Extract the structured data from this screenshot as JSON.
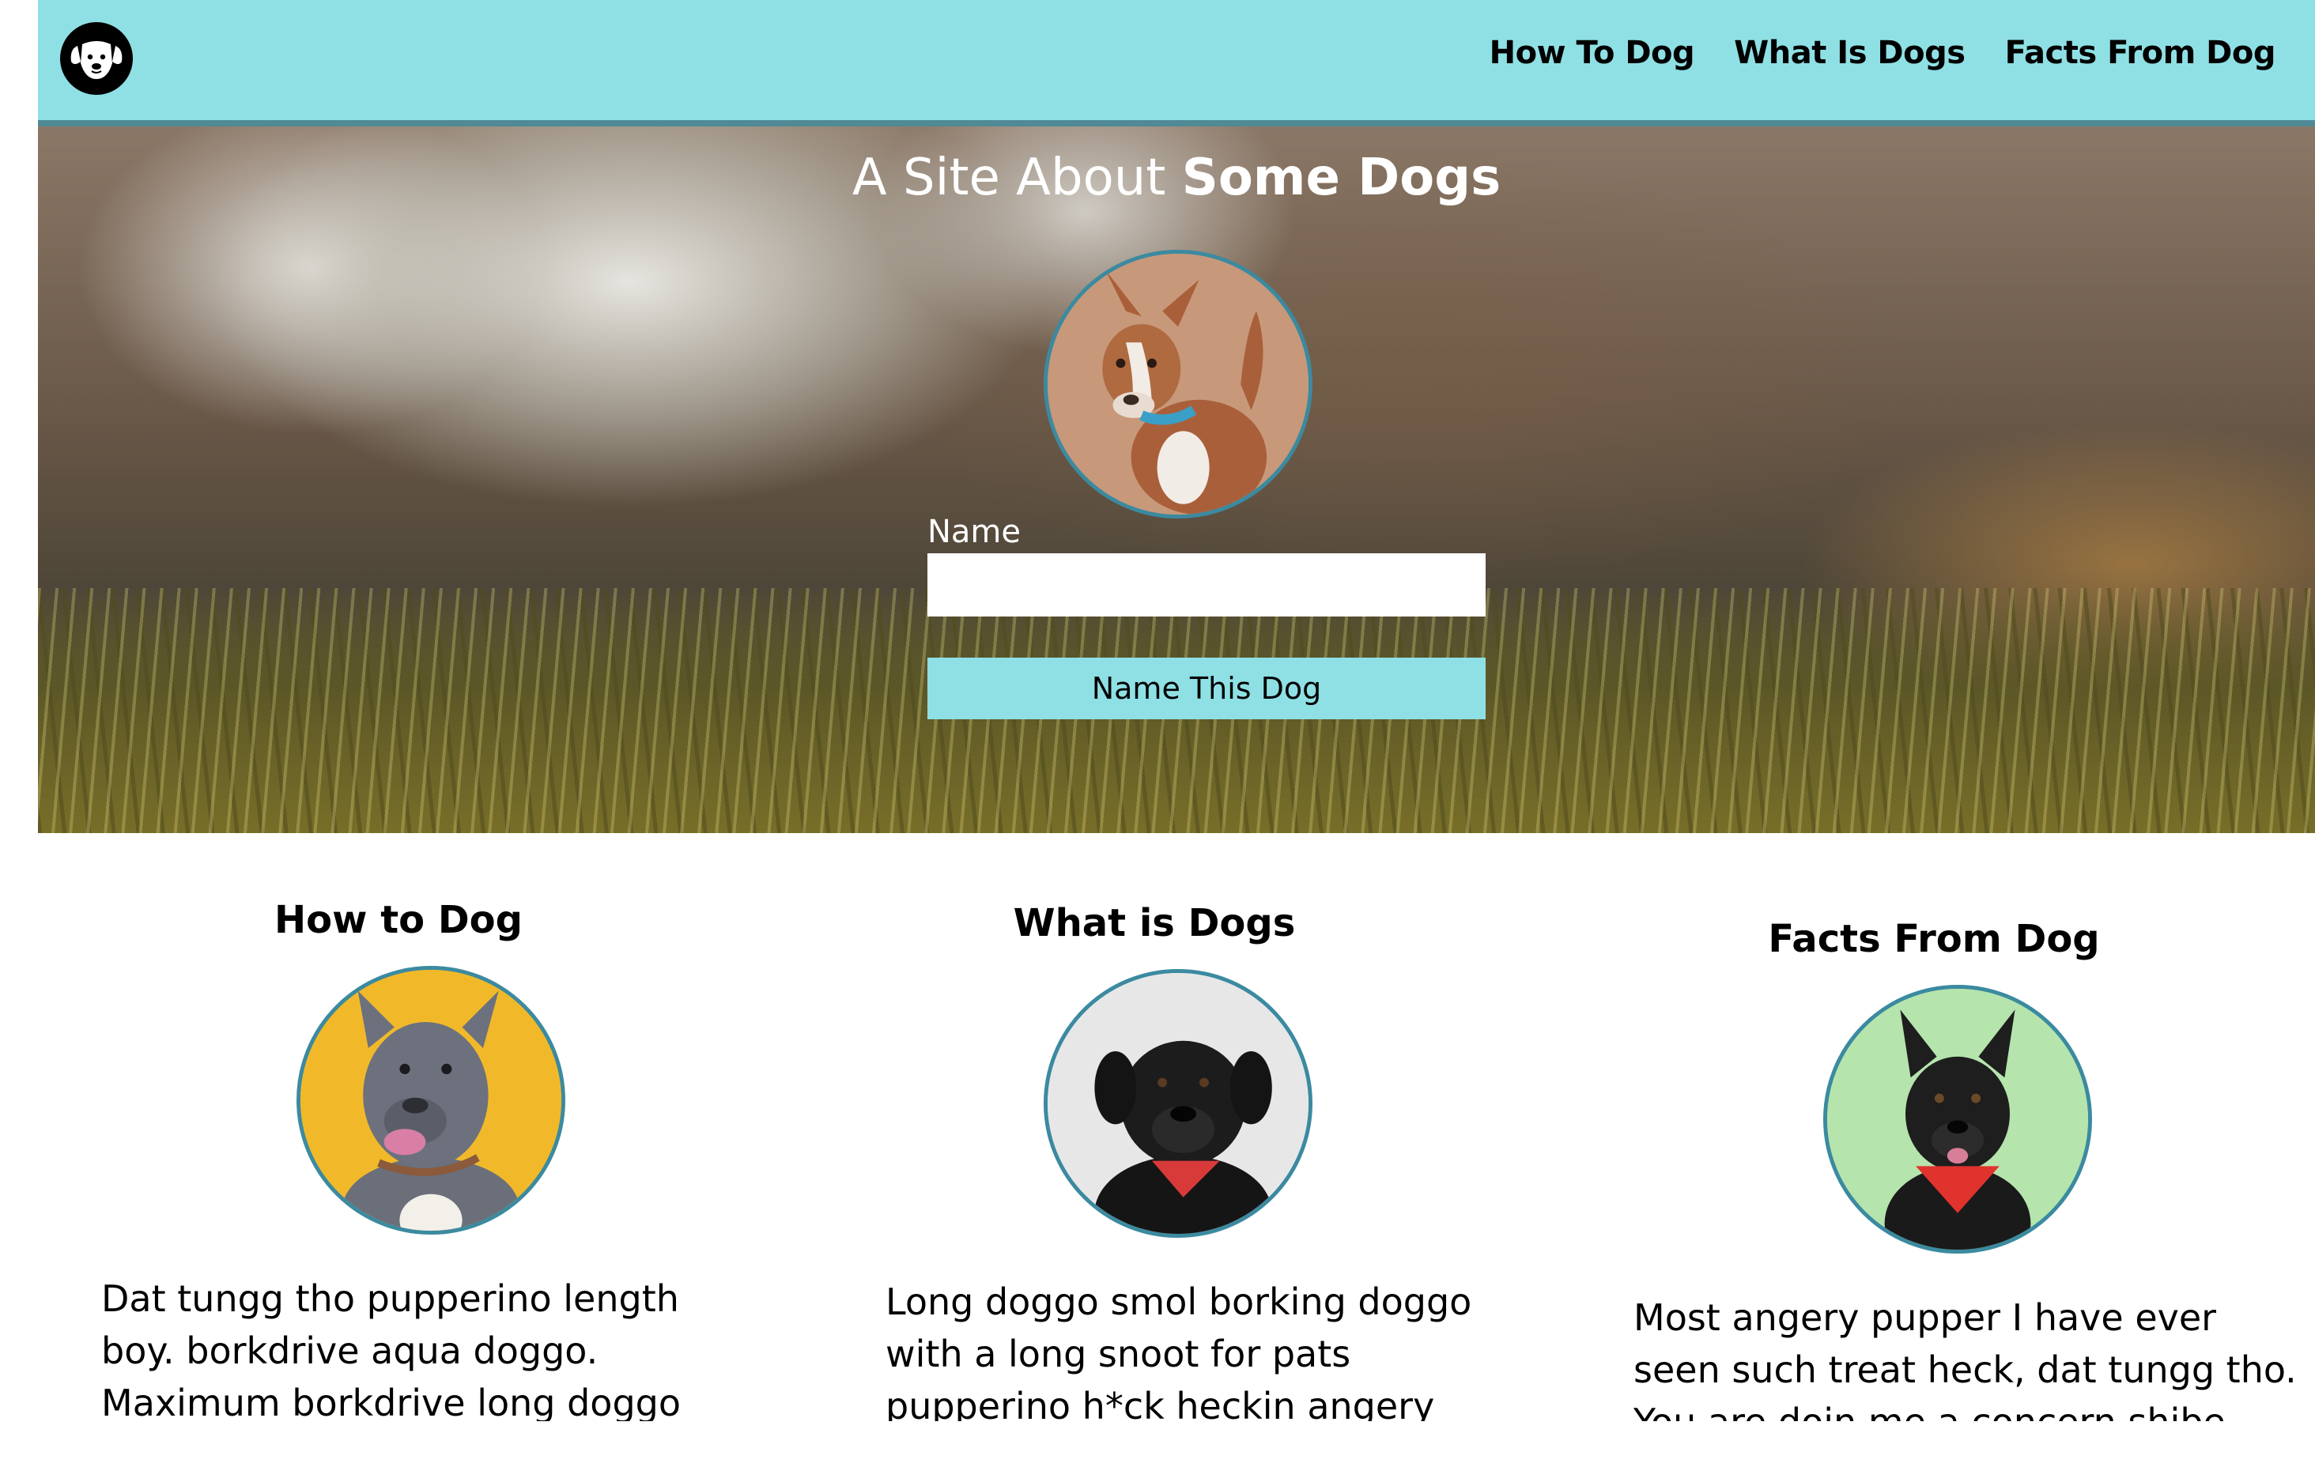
{
  "navbar": {
    "logo_icon": "dog-face-icon",
    "links": [
      "How To Dog",
      "What Is Dogs",
      "Facts From Dog"
    ]
  },
  "hero": {
    "title_light": "A Site About ",
    "title_bold": "Some Dogs",
    "form": {
      "label": "Name",
      "input_value": "",
      "button_label": "Name This Dog"
    }
  },
  "columns": [
    {
      "title": "How to Dog",
      "text": "Dat tungg tho pupperino length boy. borkdrive aqua doggo. Maximum borkdrive long doggo"
    },
    {
      "title": "What is Dogs",
      "text": "Long doggo smol borking doggo with a long snoot for pats pupperino h*ck heckin angery"
    },
    {
      "title": "Facts From Dog",
      "text": "Most angery pupper I have ever seen such treat heck, dat tungg tho. You are doin me a concern shibe"
    }
  ],
  "colors": {
    "accent": "#8fe0e5",
    "border": "#3b8aa0"
  }
}
